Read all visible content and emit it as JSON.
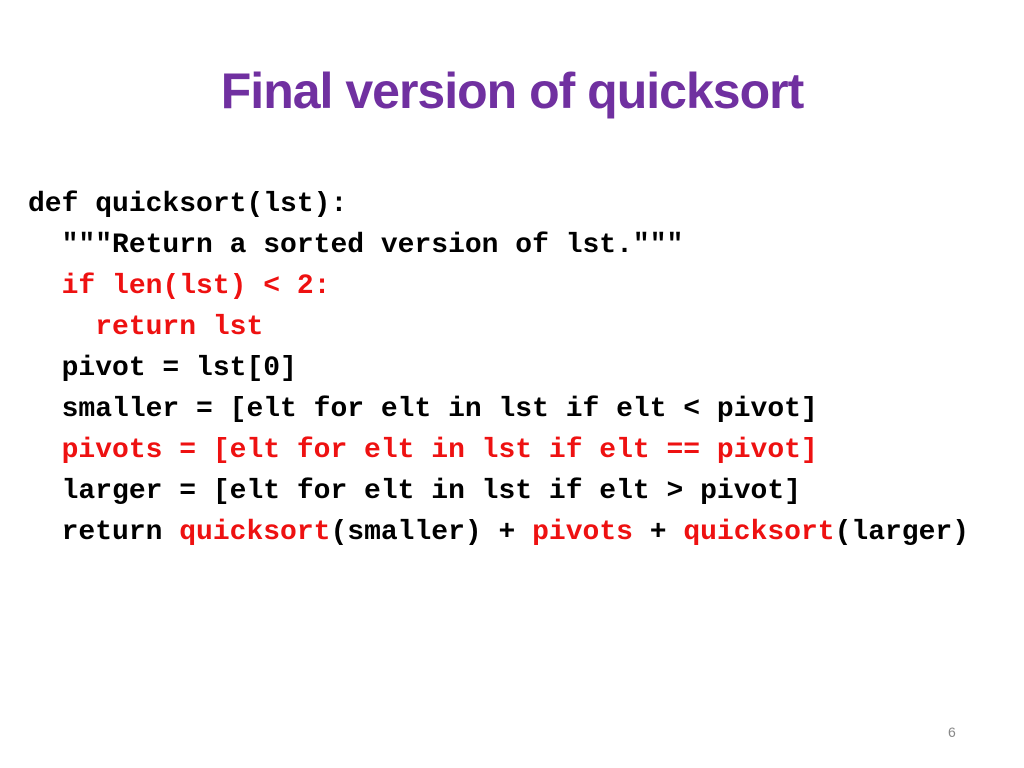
{
  "slide": {
    "title": "Final version of quicksort",
    "page_number": "6",
    "colors": {
      "title": "#7030A0",
      "code": "#000000",
      "highlight": "#EE1111"
    },
    "code_lines": [
      {
        "indent": "",
        "segments": [
          {
            "text": "def quicksort(lst):",
            "highlight": false
          }
        ]
      },
      {
        "indent": "  ",
        "segments": [
          {
            "text": "\"\"\"Return a sorted version of lst.\"\"\"",
            "highlight": false
          }
        ]
      },
      {
        "indent": "  ",
        "segments": [
          {
            "text": "if len(lst) < 2:",
            "highlight": true
          }
        ]
      },
      {
        "indent": "    ",
        "segments": [
          {
            "text": "return lst",
            "highlight": true
          }
        ]
      },
      {
        "indent": "  ",
        "segments": [
          {
            "text": "pivot = lst[0]",
            "highlight": false
          }
        ]
      },
      {
        "indent": "  ",
        "segments": [
          {
            "text": "smaller = [elt for elt in lst if elt < pivot]",
            "highlight": false
          }
        ]
      },
      {
        "indent": "  ",
        "segments": [
          {
            "text": "pivots = [elt for elt in lst if elt == pivot]",
            "highlight": true
          }
        ]
      },
      {
        "indent": "  ",
        "segments": [
          {
            "text": "larger = [elt for elt in lst if elt > pivot]",
            "highlight": false
          }
        ]
      },
      {
        "indent": "  ",
        "segments": [
          {
            "text": "return ",
            "highlight": false
          },
          {
            "text": "quicksort",
            "highlight": true
          },
          {
            "text": "(smaller) + ",
            "highlight": false
          },
          {
            "text": "pivots",
            "highlight": true
          },
          {
            "text": " + ",
            "highlight": false
          },
          {
            "text": "quicksort",
            "highlight": true
          },
          {
            "text": "(larger)",
            "highlight": false
          }
        ]
      }
    ]
  }
}
